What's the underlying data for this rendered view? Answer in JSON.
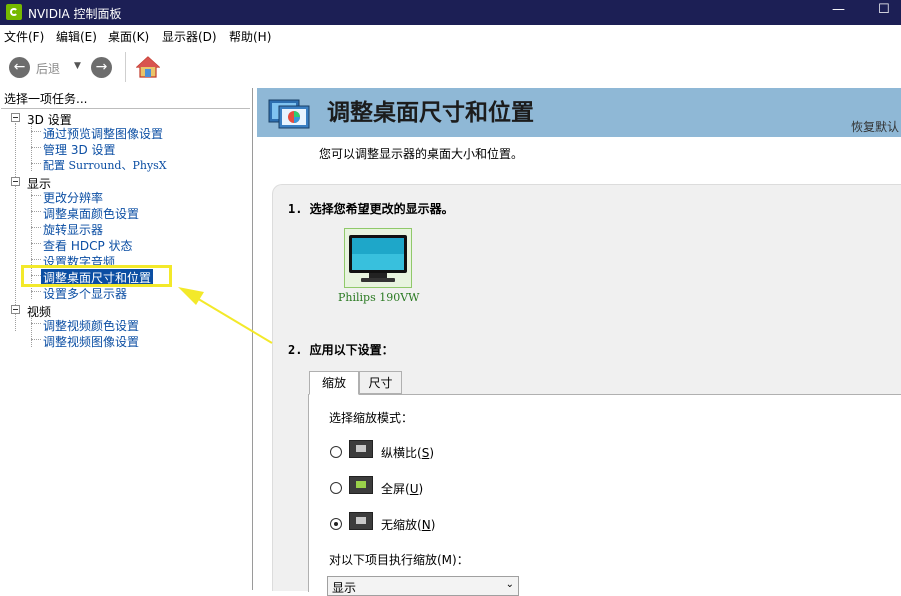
{
  "window": {
    "title": "NVIDIA 控制面板",
    "minimize": "—",
    "maximize": "☐"
  },
  "menu": [
    "文件(F)",
    "编辑(E)",
    "桌面(K)",
    "显示器(D)",
    "帮助(H)"
  ],
  "toolbar": {
    "back_label": "后退"
  },
  "sidebar": {
    "header": "选择一项任务...",
    "categories": [
      {
        "label": "3D 设置",
        "items": [
          "通过预览调整图像设置",
          "管理 3D 设置",
          "配置 Surround、PhysX"
        ]
      },
      {
        "label": "显示",
        "items": [
          "更改分辨率",
          "调整桌面颜色设置",
          "旋转显示器",
          "查看 HDCP 状态",
          "设置数字音频",
          "调整桌面尺寸和位置",
          "设置多个显示器"
        ]
      },
      {
        "label": "视频",
        "items": [
          "调整视频颜色设置",
          "调整视频图像设置"
        ]
      }
    ],
    "selected_item": "调整桌面尺寸和位置"
  },
  "main": {
    "title": "调整桌面尺寸和位置",
    "restore": "恢复默认",
    "subtitle": "您可以调整显示器的桌面大小和位置。",
    "step1": "1. 选择您希望更改的显示器。",
    "monitor_name": "Philips 190VW",
    "step2": "2. 应用以下设置：",
    "tabs": [
      "缩放",
      "尺寸"
    ],
    "active_tab": "缩放",
    "scaling_label": "选择缩放模式：",
    "modes": [
      {
        "label": "纵横比",
        "accel": "S",
        "checked": false
      },
      {
        "label": "全屏",
        "accel": "U",
        "checked": false
      },
      {
        "label": "无缩放",
        "accel": "N",
        "checked": true
      }
    ],
    "perform_label": "对以下项目执行缩放(M)：",
    "perform_value": "显示"
  },
  "colors": {
    "titlebar": "#1c1f55",
    "banner": "#8fb8d6",
    "link": "#0b4ea3",
    "highlight": "#f3e92a",
    "nvidia_green": "#76b900"
  }
}
